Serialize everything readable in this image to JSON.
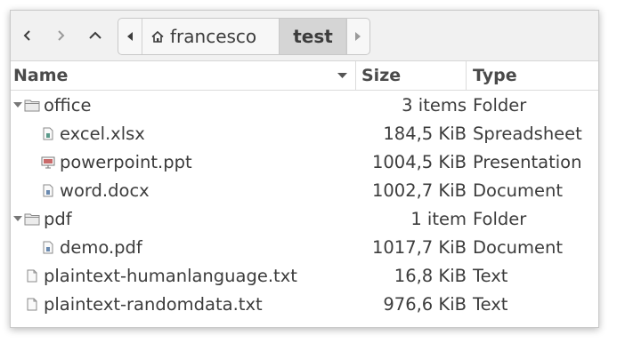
{
  "path": {
    "home": "francesco",
    "current": "test"
  },
  "columns": {
    "name": "Name",
    "size": "Size",
    "type": "Type"
  },
  "rows": [
    {
      "name": "office",
      "size": "3 items",
      "type": "Folder",
      "icon": "folder-icon",
      "expanded": true
    },
    {
      "name": "excel.xlsx",
      "size": "184,5 KiB",
      "type": "Spreadsheet",
      "icon": "spreadsheet-file-icon"
    },
    {
      "name": "powerpoint.ppt",
      "size": "1004,5 KiB",
      "type": "Presentation",
      "icon": "presentation-file-icon"
    },
    {
      "name": "word.docx",
      "size": "1002,7 KiB",
      "type": "Document",
      "icon": "document-file-icon"
    },
    {
      "name": "pdf",
      "size": "1 item",
      "type": "Folder",
      "icon": "folder-icon",
      "expanded": true
    },
    {
      "name": "demo.pdf",
      "size": "1017,7 KiB",
      "type": "Document",
      "icon": "document-file-icon"
    },
    {
      "name": "plaintext-humanlanguage.txt",
      "size": "16,8 KiB",
      "type": "Text",
      "icon": "text-file-icon"
    },
    {
      "name": "plaintext-randomdata.txt",
      "size": "976,6 KiB",
      "type": "Text",
      "icon": "text-file-icon"
    }
  ],
  "colors": {
    "toolbar_bg": "#f1f1f1",
    "current_crumb_bg": "#d5d5d5",
    "text": "#3c3c3c"
  }
}
